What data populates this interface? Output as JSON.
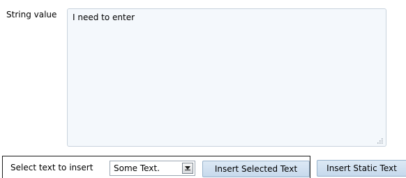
{
  "form": {
    "string_value_label": "String value",
    "string_value_text": "I need to enter"
  },
  "insert_bar": {
    "select_label": "Select text to insert",
    "select_value": "Some Text.",
    "insert_selected_label": "Insert Selected Text",
    "insert_static_label": "Insert Static Text"
  },
  "icons": {
    "dropdown": "chevron-down-icon",
    "resize": "resize-grip-icon"
  },
  "colors": {
    "textarea_background": "#f4f8fc",
    "button_background": "#c6d9ec",
    "button_border": "#97b2cb"
  }
}
